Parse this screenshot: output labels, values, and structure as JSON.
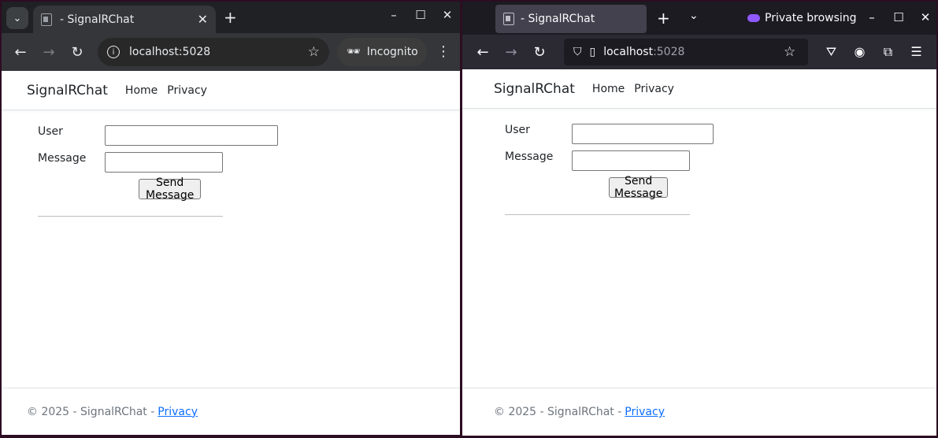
{
  "left_window": {
    "tab_title": "- SignalRChat",
    "url": "localhost:5028",
    "mode_label": "Incognito"
  },
  "right_window": {
    "tab_title": "- SignalRChat",
    "mode_label": "Private browsing",
    "url_host": "localhost",
    "url_port": ":5028"
  },
  "page": {
    "brand": "SignalRChat",
    "nav": [
      "Home",
      "Privacy"
    ],
    "user_label": "User",
    "message_label": "Message",
    "user_value": "",
    "message_value": "",
    "send_label": "Send Message",
    "footer_text": "© 2025 - SignalRChat -",
    "footer_link": "Privacy"
  },
  "icons": {
    "tab_search": "chevron-down-icon",
    "close": "close-icon",
    "info": "info-icon",
    "star": "star-icon",
    "incognito": "incognito-icon",
    "menu": "menu-icon"
  }
}
